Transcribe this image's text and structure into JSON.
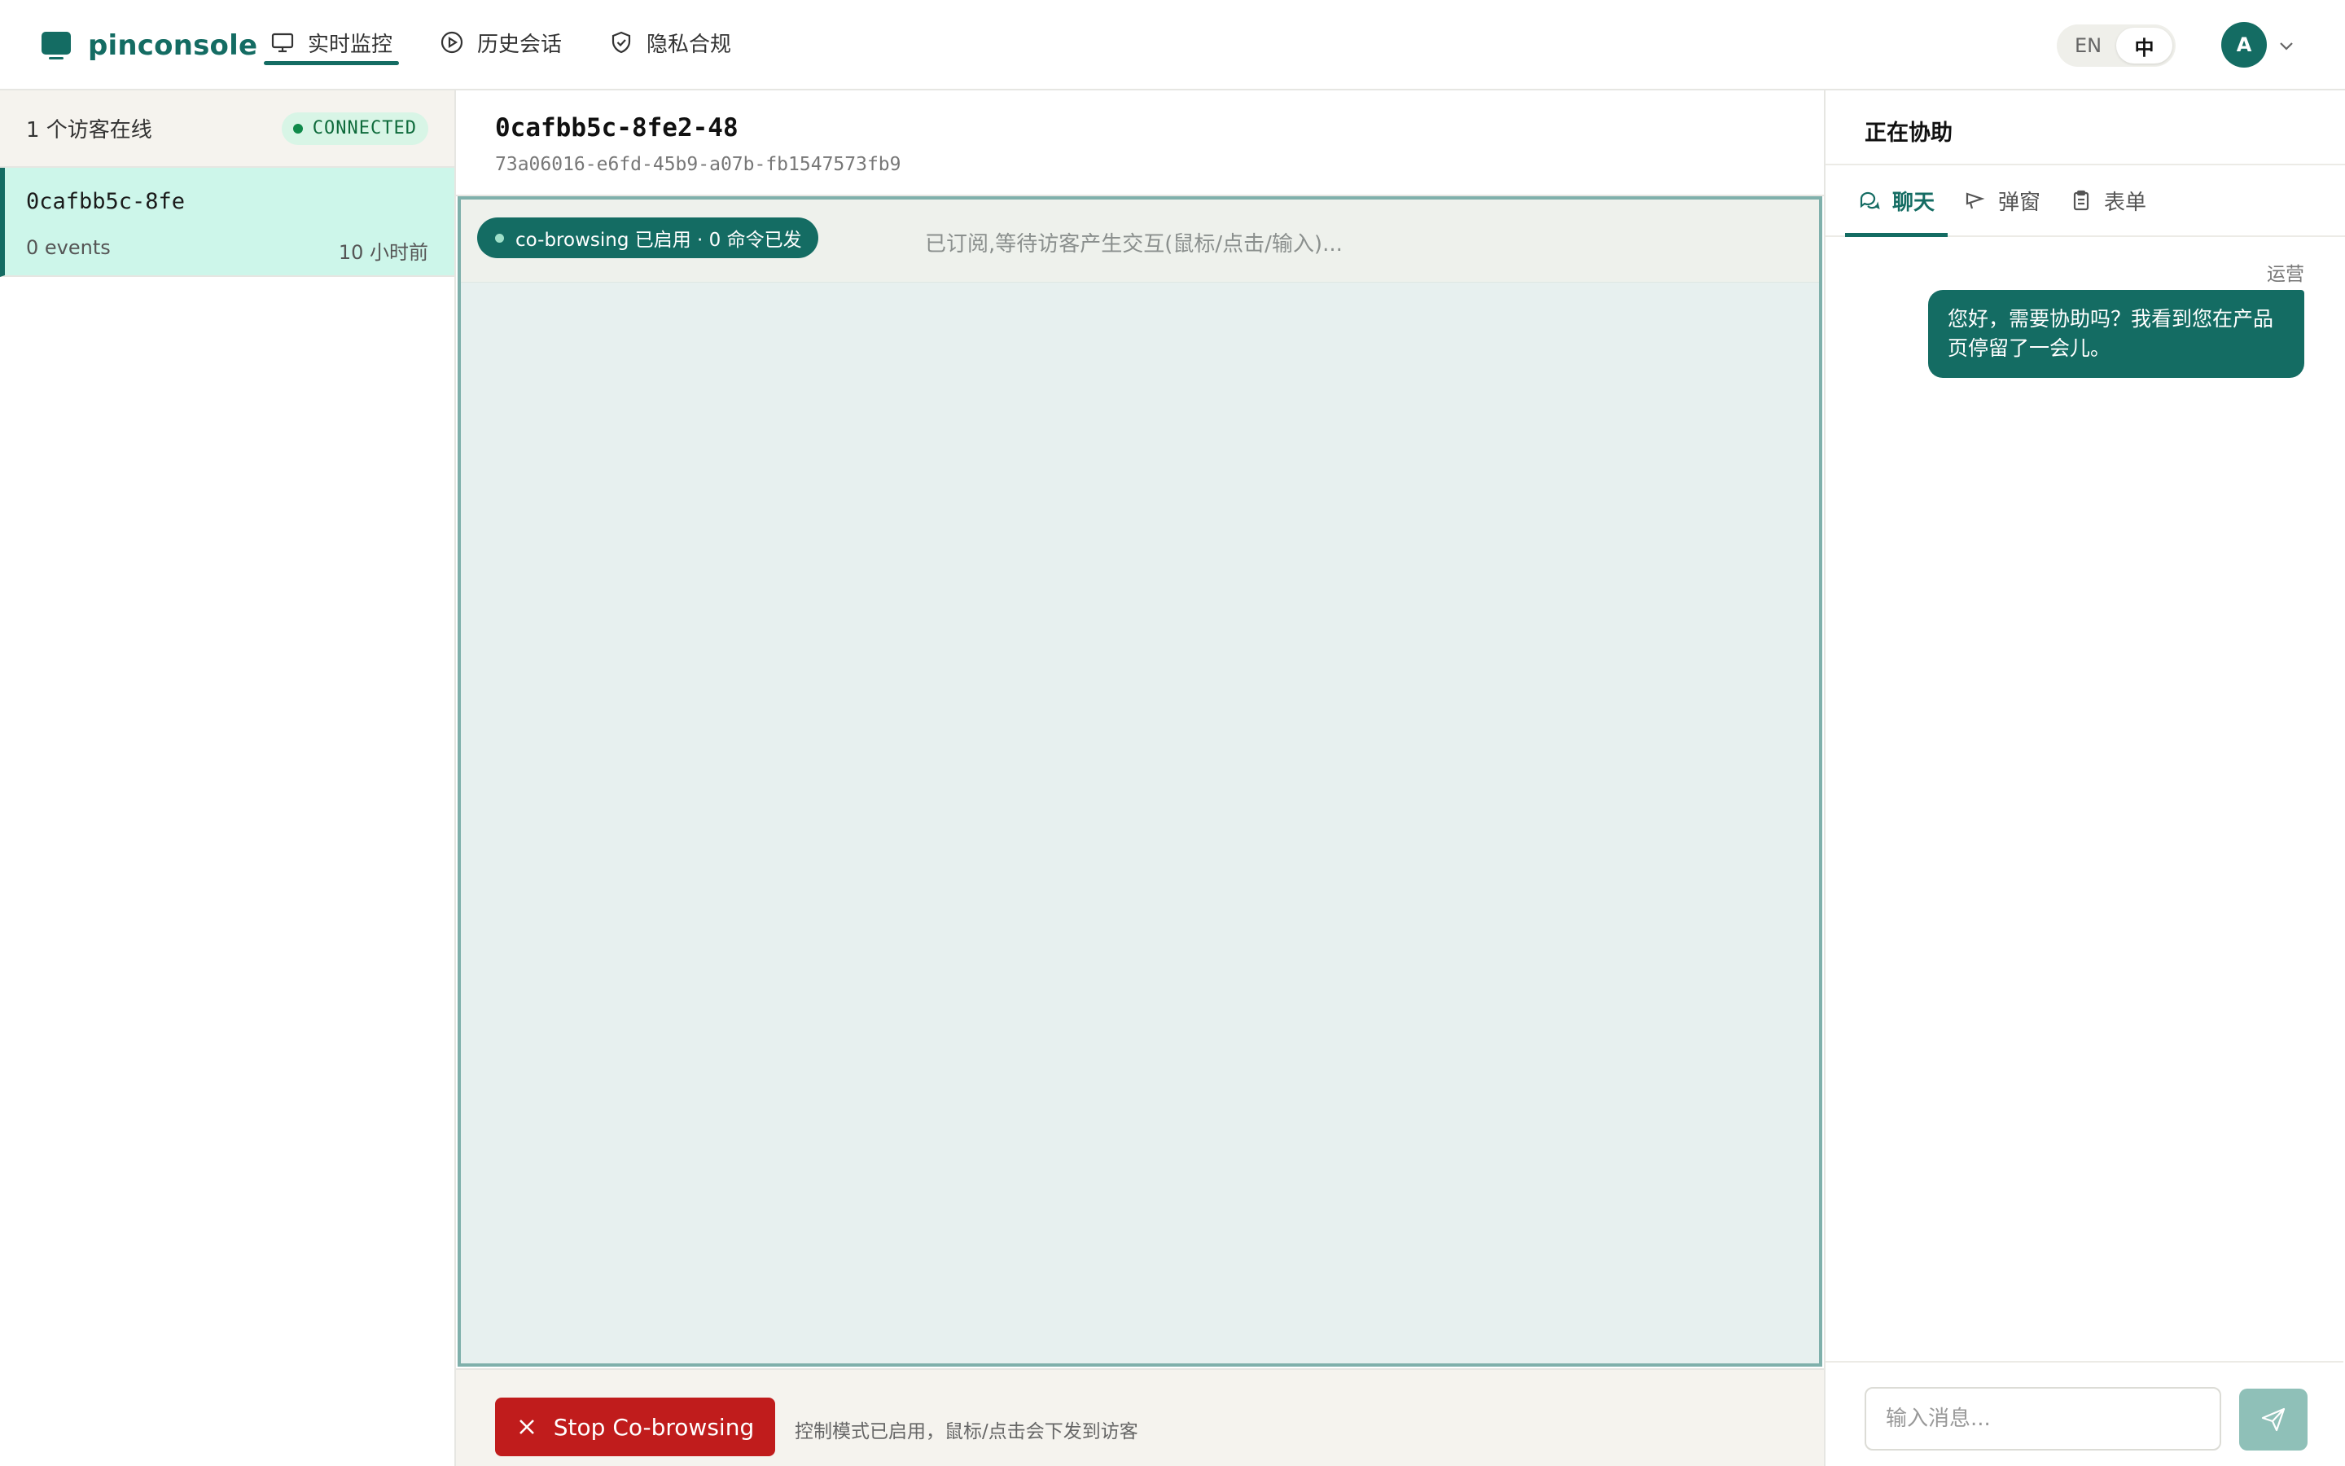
{
  "brand": {
    "name": "pinconsole"
  },
  "nav": {
    "items": [
      {
        "label": "实时监控",
        "icon": "monitor-icon",
        "active": true
      },
      {
        "label": "历史会话",
        "icon": "play-circle-icon",
        "active": false
      },
      {
        "label": "隐私合规",
        "icon": "shield-check-icon",
        "active": false
      }
    ]
  },
  "lang": {
    "en": "EN",
    "zh": "中",
    "selected": "中"
  },
  "user": {
    "avatar_initial": "A"
  },
  "sidebar": {
    "online_count": "1 个访客在线",
    "status": "CONNECTED",
    "visitors": [
      {
        "id": "0cafbb5c-8fe",
        "events": "0 events",
        "time": "10 小时前"
      }
    ]
  },
  "session": {
    "title": "0cafbb5c-8fe2-48",
    "full_id": "73a06016-e6fd-45b9-a07b-fb1547573fb9",
    "cobrowse_pill": "co-browsing 已启用 · 0 命令已发",
    "viewport_status": "已订阅,等待访客产生交互(鼠标/点击/输入)...",
    "stop_button": "Stop Co-browsing",
    "control_hint": "控制模式已启用，鼠标/点击会下发到访客"
  },
  "assist": {
    "title": "正在协助",
    "tabs": [
      {
        "label": "聊天",
        "icon": "chat-icon",
        "active": true
      },
      {
        "label": "弹窗",
        "icon": "megaphone-icon",
        "active": false
      },
      {
        "label": "表单",
        "icon": "clipboard-icon",
        "active": false
      }
    ],
    "messages": [
      {
        "sender": "运营",
        "text": "您好，需要协助吗？我看到您在产品页停留了一会儿。"
      }
    ],
    "input_placeholder": "输入消息..."
  },
  "colors": {
    "brand": "#146c63",
    "selected_row": "#cdf6ea",
    "connected_badge": "#d8f5e6",
    "stop_button": "#c01c1c",
    "send_disabled": "#8fc0b8"
  }
}
